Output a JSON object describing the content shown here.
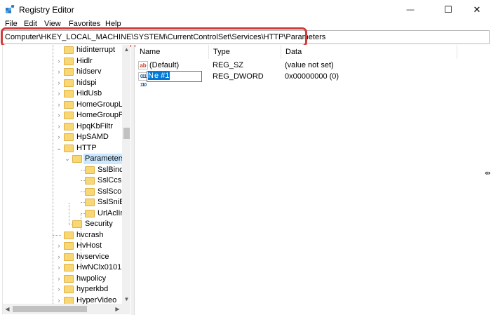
{
  "window": {
    "title": "Registry Editor",
    "minimize_glyph": "—",
    "maximize_glyph": "☐",
    "close_glyph": "✕"
  },
  "menu": [
    "File",
    "Edit",
    "View",
    "Favorites",
    "Help"
  ],
  "address": {
    "path": "Computer\\HKEY_LOCAL_MACHINE\\SYSTEM\\CurrentControlSet\\Services\\HTTP\\Parameters"
  },
  "highlight_color": "#d23b3b",
  "tree": [
    {
      "label": "hidinterrupt",
      "depth": 0,
      "twisty": "",
      "selected": false
    },
    {
      "label": "Hidlr",
      "depth": 0,
      "twisty": "›",
      "selected": false
    },
    {
      "label": "hidserv",
      "depth": 0,
      "twisty": "›",
      "selected": false
    },
    {
      "label": "hidspi",
      "depth": 0,
      "twisty": "›",
      "selected": false
    },
    {
      "label": "HidUsb",
      "depth": 0,
      "twisty": "›",
      "selected": false
    },
    {
      "label": "HomeGroupLi",
      "depth": 0,
      "twisty": "›",
      "selected": false
    },
    {
      "label": "HomeGroupPr",
      "depth": 0,
      "twisty": "›",
      "selected": false
    },
    {
      "label": "HpqKbFiltr",
      "depth": 0,
      "twisty": "›",
      "selected": false
    },
    {
      "label": "HpSAMD",
      "depth": 0,
      "twisty": "›",
      "selected": false
    },
    {
      "label": "HTTP",
      "depth": 0,
      "twisty": "⌄",
      "selected": false
    },
    {
      "label": "Parameters",
      "depth": 1,
      "twisty": "⌄",
      "selected": true
    },
    {
      "label": "SslBindin",
      "depth": 2,
      "twisty": "",
      "selected": false
    },
    {
      "label": "SslCcsBi",
      "depth": 2,
      "twisty": "",
      "selected": false
    },
    {
      "label": "SslScope",
      "depth": 2,
      "twisty": "",
      "selected": false
    },
    {
      "label": "SslSniBir",
      "depth": 2,
      "twisty": "",
      "selected": false
    },
    {
      "label": "UrlAclInf",
      "depth": 2,
      "twisty": "",
      "selected": false
    },
    {
      "label": "Security",
      "depth": 1,
      "twisty": "",
      "selected": false
    },
    {
      "label": "hvcrash",
      "depth": 0,
      "twisty": "",
      "selected": false
    },
    {
      "label": "HvHost",
      "depth": 0,
      "twisty": "›",
      "selected": false
    },
    {
      "label": "hvservice",
      "depth": 0,
      "twisty": "›",
      "selected": false
    },
    {
      "label": "HwNClx0101",
      "depth": 0,
      "twisty": "›",
      "selected": false
    },
    {
      "label": "hwpolicy",
      "depth": 0,
      "twisty": "›",
      "selected": false
    },
    {
      "label": "hyperkbd",
      "depth": 0,
      "twisty": "›",
      "selected": false
    },
    {
      "label": "HyperVideo",
      "depth": 0,
      "twisty": "›",
      "selected": false
    }
  ],
  "list": {
    "columns": [
      "Name",
      "Type",
      "Data"
    ],
    "rows": [
      {
        "icon": "string-value-icon",
        "icon_glyph": "ab",
        "name": "(Default)",
        "type": "REG_SZ",
        "data": "(value not set)",
        "editing": false
      },
      {
        "icon": "binary-value-icon",
        "icon_glyph": "011 110",
        "name": "e #1",
        "name_prefix": "N",
        "type": "REG_DWORD",
        "data": "0x00000000 (0)",
        "editing": true
      }
    ]
  },
  "scroll_arrows": {
    "up": "▲",
    "down": "▼",
    "left": "◀",
    "right": "▶"
  },
  "cursor_glyph": "⇹"
}
